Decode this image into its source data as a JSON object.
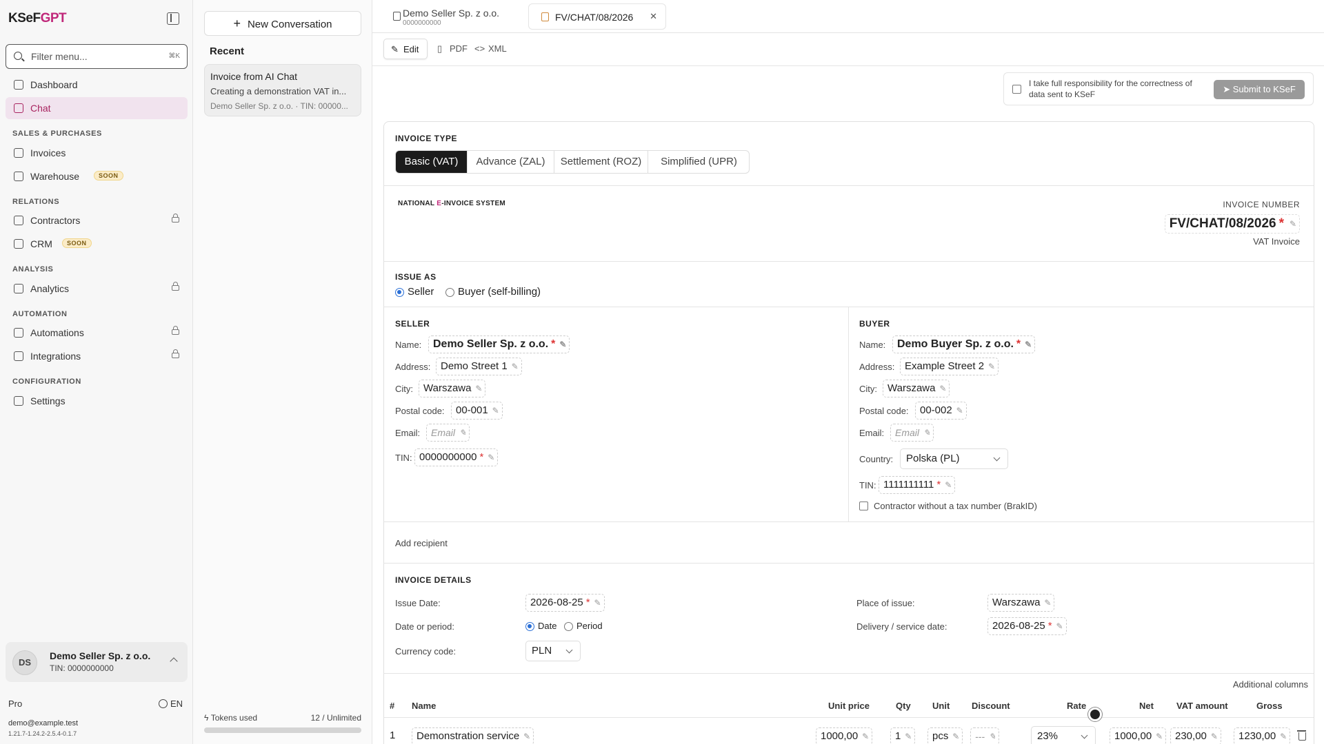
{
  "app": {
    "logo_main": "KSeF",
    "logo_accent": "GPT",
    "filter_placeholder": "Filter menu...",
    "filter_shortcut": "⌘K"
  },
  "sidebar": {
    "dashboard": "Dashboard",
    "chat": "Chat",
    "sec_sales": "SALES & PURCHASES",
    "invoices": "Invoices",
    "warehouse": "Warehouse",
    "soon": "SOON",
    "sec_relations": "RELATIONS",
    "contractors": "Contractors",
    "crm": "CRM",
    "sec_analysis": "ANALYSIS",
    "analytics": "Analytics",
    "sec_automation": "AUTOMATION",
    "automations": "Automations",
    "integrations": "Integrations",
    "sec_config": "CONFIGURATION",
    "settings": "Settings"
  },
  "account": {
    "initials": "DS",
    "name": "Demo Seller Sp. z o.o.",
    "tin": "TIN: 0000000000",
    "plan": "Pro",
    "lang": "EN",
    "email": "demo@example.test",
    "version": "1.21.7-1.24.2-2.5.4-0.1.7"
  },
  "conversations": {
    "new_label": "New Conversation",
    "recent": "Recent",
    "item_title": "Invoice from AI Chat",
    "item_preview": "Creating a demonstration VAT in...",
    "item_sub": "Demo Seller Sp. z o.o. · TIN: 00000...",
    "tokens_label": "Tokens used",
    "tokens_value": "12 / Unlimited"
  },
  "tabs": {
    "tab1_title": "Demo Seller Sp. z o.o.",
    "tab1_sub": "0000000000",
    "tab2_title": "FV/CHAT/08/2026"
  },
  "modes": {
    "edit": "Edit",
    "pdf": "PDF",
    "xml": "XML"
  },
  "submit": {
    "confirm": "I take full responsibility for the correctness of data sent to KSeF",
    "button": "Submit to KSeF"
  },
  "invoice": {
    "type_heading": "INVOICE TYPE",
    "types": [
      "Basic (VAT)",
      "Advance (ZAL)",
      "Settlement (ROZ)",
      "Simplified (UPR)"
    ],
    "ksef_pre": "NATIONAL ",
    "ksef_e": "E",
    "ksef_post": "-INVOICE SYSTEM",
    "number_label": "INVOICE NUMBER",
    "number": "FV/CHAT/08/2026",
    "kind": "VAT Invoice",
    "issue_as": "ISSUE AS",
    "issue_seller": "Seller",
    "issue_buyer": "Buyer (self-billing)",
    "add_recipient": "Add recipient"
  },
  "labels": {
    "name": "Name:",
    "address": "Address:",
    "city": "City:",
    "postal": "Postal code:",
    "email": "Email:",
    "tin": "TIN:",
    "country": "Country:",
    "email_ph": "Email"
  },
  "seller": {
    "heading": "SELLER",
    "name": "Demo Seller Sp. z o.o.",
    "address": "Demo Street 1",
    "city": "Warszawa",
    "postal": "00-001",
    "tin": "0000000000"
  },
  "buyer": {
    "heading": "BUYER",
    "name": "Demo Buyer Sp. z o.o.",
    "address": "Example Street 2",
    "city": "Warszawa",
    "postal": "00-002",
    "country": "Polska (PL)",
    "tin": "1111111111",
    "no_tax": "Contractor without a tax number (BrakID)"
  },
  "details": {
    "heading": "INVOICE DETAILS",
    "issue_date_label": "Issue Date:",
    "issue_date": "2026-08-25",
    "date_period_label": "Date or period:",
    "opt_date": "Date",
    "opt_period": "Period",
    "currency_label": "Currency code:",
    "currency": "PLN",
    "place_label": "Place of issue:",
    "place": "Warszawa",
    "delivery_label": "Delivery / service date:",
    "delivery": "2026-08-25",
    "additional_columns": "Additional columns"
  },
  "items": {
    "headers": [
      "#",
      "Name",
      "Unit price",
      "Qty",
      "Unit",
      "Discount",
      "Rate",
      "Net",
      "VAT amount",
      "Gross"
    ],
    "row": {
      "no": "1",
      "name": "Demonstration service",
      "price": "1000,00",
      "qty": "1",
      "unit": "pcs",
      "discount": "---",
      "rate": "23%",
      "net": "1000,00",
      "vat": "230,00",
      "gross": "1230,00"
    }
  }
}
